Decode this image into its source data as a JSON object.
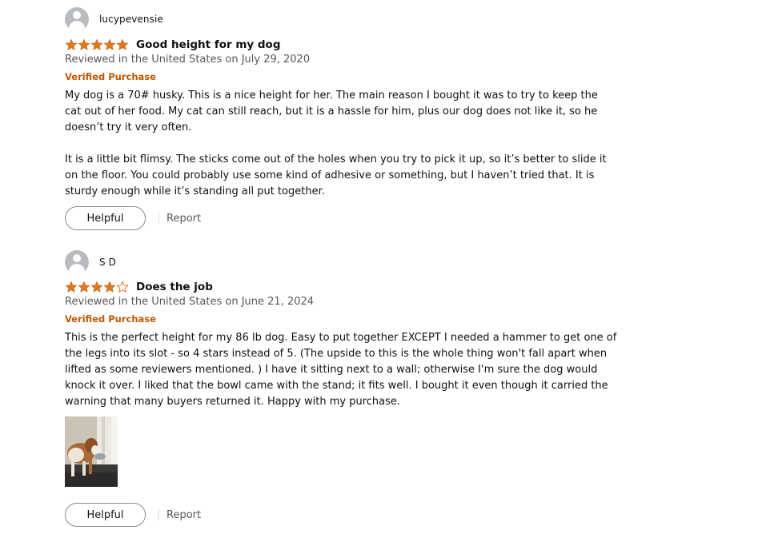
{
  "reviews": [
    {
      "profile_name": "lucypevensie",
      "rating": 5,
      "max_rating": 5,
      "title": "Good height for my dog",
      "date": "Reviewed in the United States on July 29, 2020",
      "badge": "Verified Purchase",
      "paragraphs": [
        "My dog is a 70# husky. This is a nice height for her. The main reason I bought it was to try to keep the cat out of her food. My cat can still reach, but it is a hassle for him, plus our dog does not like it, so he doesn’t try it very often.",
        "It is a little bit flimsy. The sticks come out of the holes when you try to pick it up, so it’s better to slide it on the floor. You could probably use some kind of adhesive or something, but I haven’t tried that. It is sturdy enough while it’s standing all put together."
      ],
      "helpful_label": "Helpful",
      "report_label": "Report"
    },
    {
      "profile_name": "S D",
      "rating": 4,
      "max_rating": 5,
      "title": "Does the job",
      "date": "Reviewed in the United States on June 21, 2024",
      "badge": "Verified Purchase",
      "paragraphs": [
        "This is the perfect height for my 86 lb dog. Easy to put together EXCEPT I needed a hammer to get one of the legs into its slot - so 4 stars instead of 5. (The upside to this is the whole thing won't fall apart when lifted as some reviewers mentioned. ) I have it sitting next to a wall; otherwise I'm sure the dog would knock it over. I liked that the bowl came with the stand; it fits well. I bought it even though it carried the warning that many buyers returned it. Happy with my purchase."
      ],
      "helpful_label": "Helpful",
      "report_label": "Report"
    }
  ],
  "colors": {
    "star_filled": "#de7921",
    "star_outline": "#de7921",
    "verified": "#c45500",
    "secondary_text": "#565959",
    "button_border": "#888c8c"
  },
  "icons": {
    "avatar": "default-profile-icon",
    "star_full": "star-filled-icon",
    "star_empty": "star-outline-icon"
  }
}
